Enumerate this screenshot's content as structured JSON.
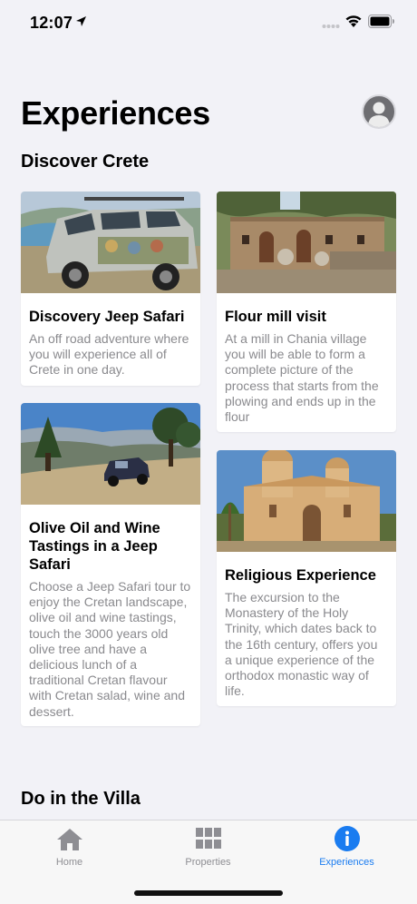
{
  "status_bar": {
    "time": "12:07",
    "icons": [
      "location-arrow-icon",
      "signal-dots-icon",
      "wifi-icon",
      "battery-icon"
    ]
  },
  "header": {
    "title": "Experiences",
    "avatar_icon": "user-avatar-icon"
  },
  "sections": {
    "discover": "Discover Crete",
    "villa": "Do in the Villa"
  },
  "cards": [
    {
      "title": "Discovery Jeep Safari",
      "description": "An off road adventure where you will experience all of Crete in one day."
    },
    {
      "title": "Flour mill visit",
      "description": "At a mill in Chania village you will be able to form a complete picture of the process that starts from the plowing and ends up in the flour"
    },
    {
      "title": "Olive Oil and Wine Tastings in a Jeep Safari",
      "description": "Choose a Jeep Safari tour to enjoy the Cretan landscape, olive oil and wine tastings, touch the 3000 years old olive tree and have a delicious lunch of a traditional Cretan flavour with Cretan salad, wine and dessert."
    },
    {
      "title": "Religious Experience",
      "description": "The excursion to the Monastery of the Holy Trinity, which dates back to the 16th century, offers you a unique experience of the orthodox monastic way of life."
    }
  ],
  "tab_bar": {
    "tabs": [
      {
        "label": "Home",
        "icon": "home-icon"
      },
      {
        "label": "Properties",
        "icon": "grid-icon"
      },
      {
        "label": "Experiences",
        "icon": "info-icon"
      }
    ],
    "active_tab": "Experiences",
    "active_color": "#1a7cf0"
  },
  "colors": {
    "background": "#f2f2f7",
    "card": "#ffffff",
    "secondary_text": "#8a8a8e"
  }
}
